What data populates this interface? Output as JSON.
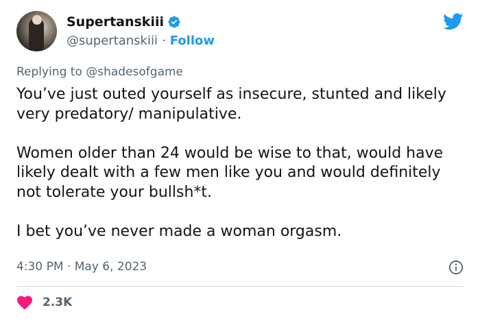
{
  "author": {
    "display_name": "Supertanskiii",
    "handle": "@supertanskiii",
    "separator": "·",
    "follow_label": "Follow"
  },
  "reply": {
    "prefix": "Replying to",
    "mention": "@shadesofgame"
  },
  "tweet": {
    "paragraphs": [
      "You’ve just outed yourself as insecure, stunted and likely very predatory/ manipulative.",
      "Women older than 24 would be wise to that, would have likely dealt with a few men like you and would definitely not tolerate your bullsh*t.",
      "I bet you’ve never made a woman orgasm."
    ],
    "time": "4:30 PM",
    "separator": "·",
    "date": "May 6, 2023"
  },
  "engagement": {
    "likes": "2.3K"
  },
  "colors": {
    "accent": "#1d9bf0",
    "heart": "#f91880",
    "muted": "#536471"
  },
  "icons": {
    "verified": "verified-badge-icon",
    "platform": "twitter-bird-icon",
    "info": "info-icon",
    "like": "heart-icon"
  }
}
